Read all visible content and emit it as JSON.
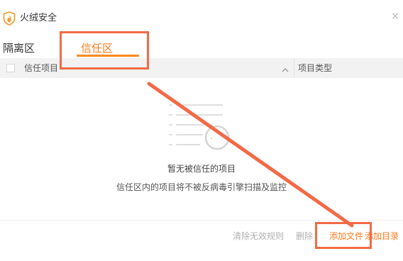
{
  "window": {
    "title": "火绒安全",
    "close_label": "×"
  },
  "tabs": [
    {
      "label": "隔离区",
      "active": false
    },
    {
      "label": "信任区",
      "active": true
    }
  ],
  "table": {
    "columns": [
      "信任项目",
      "项目类型"
    ],
    "rows": []
  },
  "empty_state": {
    "title": "暂无被信任的项目",
    "description": "信任区内的项目将不被反病毒引擎扫描及监控"
  },
  "footer": {
    "clear_invalid_rules": "清除无效规则",
    "delete": "删除",
    "add_file": "添加文件",
    "add_directory": "添加目录"
  },
  "icons": {
    "logo": "huorong-flame-shield-icon",
    "close": "close-icon",
    "sort": "chevron-up-icon",
    "empty": "empty-list-search-icon"
  },
  "colors": {
    "accent": "#ff7a1a",
    "annotation": "#f26a45",
    "header_bg": "#f2f2f2",
    "disabled_text": "#b0b0b0"
  }
}
